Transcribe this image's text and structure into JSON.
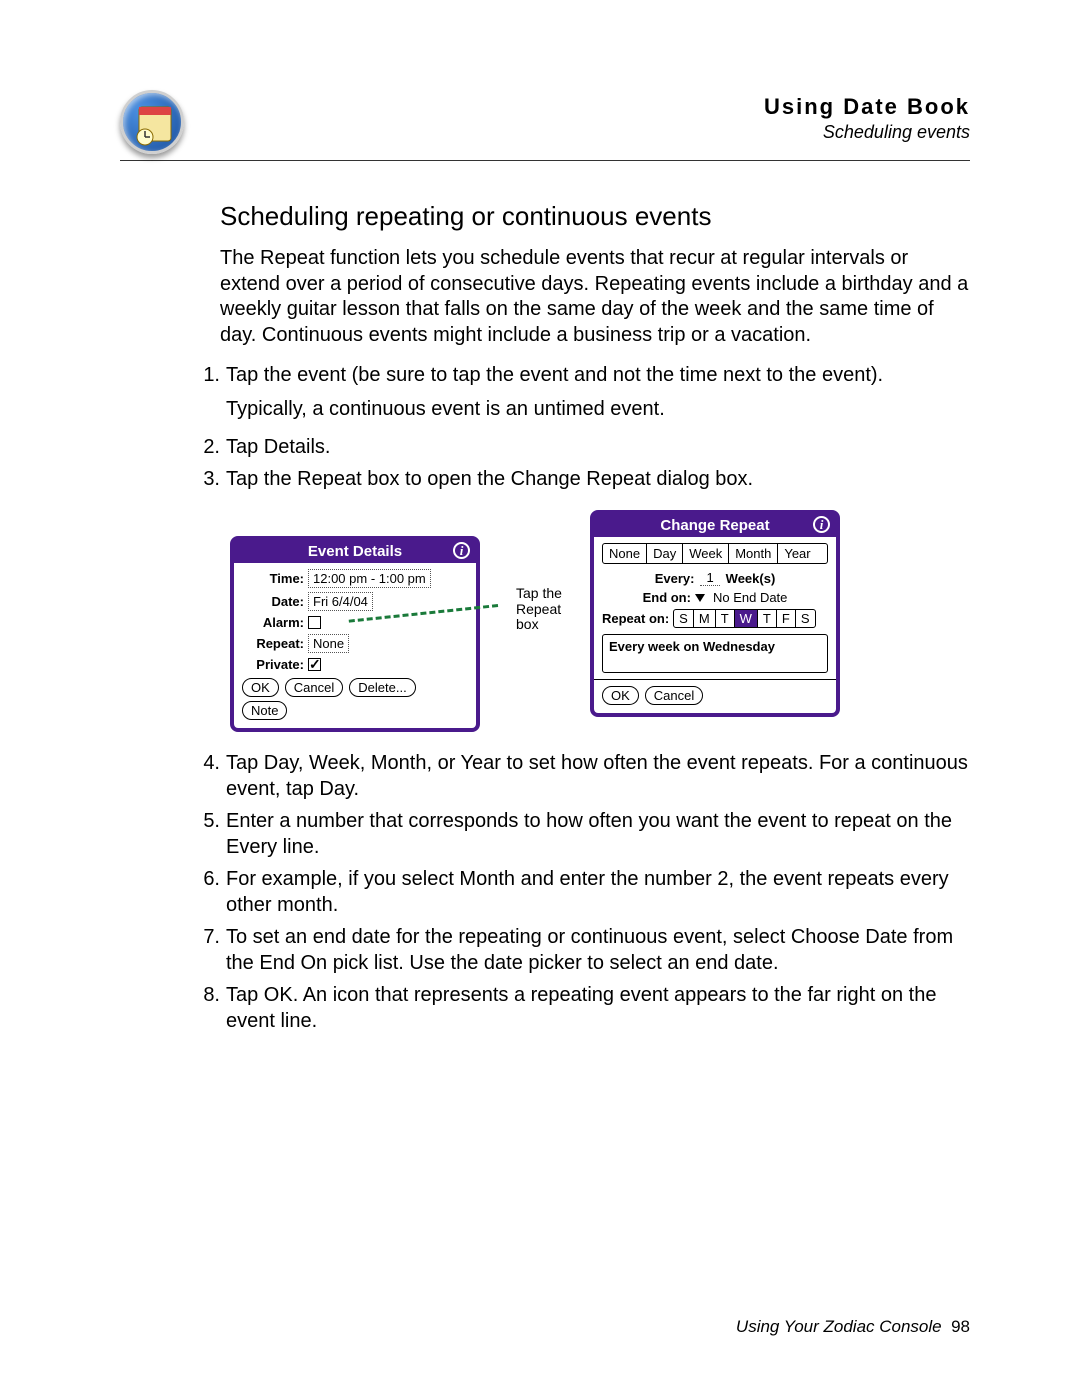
{
  "header": {
    "chapter": "Using Date Book",
    "section": "Scheduling events"
  },
  "main": {
    "heading": "Scheduling repeating or continuous events",
    "intro": "The Repeat function lets you schedule events that recur at regular intervals or extend over a period of consecutive days. Repeating events include a birthday and a weekly guitar lesson that falls on the same day of the week and the same time of day. Continuous events might include a business trip or a vacation."
  },
  "steps": {
    "s1": "Tap the event (be sure to tap the event and not the time next to the event).",
    "s1b": "Typically, a continuous event is an untimed event.",
    "s2": "Tap Details.",
    "s3": "Tap the Repeat box to open the Change Repeat dialog box.",
    "s4": "Tap Day, Week, Month, or Year to set how often the event repeats. For a continuous event, tap Day.",
    "s5": "Enter a number that corresponds to how often you want the event to repeat on the Every line.",
    "s6": "For example, if you select Month and enter the number 2, the event repeats every other month.",
    "s7": "To set an end date for the repeating or continuous event, select Choose Date from the End On pick list. Use the date picker to select an end date.",
    "s8": "Tap OK. An icon that represents a repeating event appears to the far right on the event line."
  },
  "callout": {
    "l1": "Tap the",
    "l2": "Repeat",
    "l3": "box"
  },
  "event_details": {
    "title": "Event Details",
    "labels": {
      "time": "Time:",
      "date": "Date:",
      "alarm": "Alarm:",
      "repeat": "Repeat:",
      "private": "Private:"
    },
    "time": "12:00 pm - 1:00 pm",
    "date": "Fri 6/4/04",
    "repeat": "None",
    "buttons": {
      "ok": "OK",
      "cancel": "Cancel",
      "delete": "Delete...",
      "note": "Note"
    }
  },
  "change_repeat": {
    "title": "Change Repeat",
    "tabs": {
      "none": "None",
      "day": "Day",
      "week": "Week",
      "month": "Month",
      "year": "Year"
    },
    "every_label": "Every:",
    "every_value": "1",
    "every_unit": "Week(s)",
    "end_label": "End on:",
    "end_value": "No End Date",
    "repeat_on_label": "Repeat on:",
    "days": {
      "s": "S",
      "m": "M",
      "t1": "T",
      "w": "W",
      "t2": "T",
      "f": "F",
      "s2": "S"
    },
    "summary": "Every week on Wednesday",
    "buttons": {
      "ok": "OK",
      "cancel": "Cancel"
    }
  },
  "footer": {
    "book": "Using Your Zodiac Console",
    "page": "98"
  }
}
